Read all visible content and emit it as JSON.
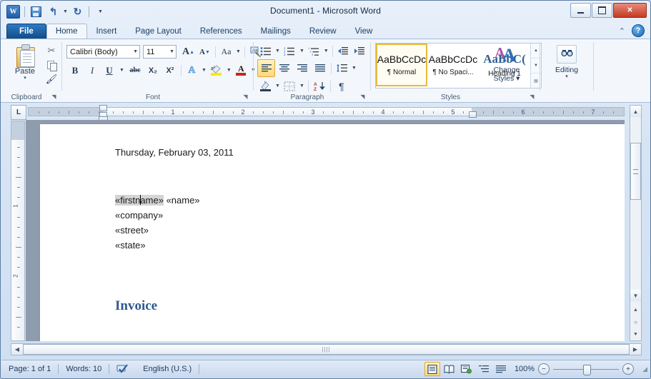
{
  "window": {
    "title": "Document1  -  Microsoft Word",
    "minimize_label": "Minimize",
    "maximize_label": "Maximize",
    "close_label": "✕"
  },
  "quick_access": {
    "app_logo": "W",
    "items": [
      {
        "name": "save-icon",
        "label": "Save"
      },
      {
        "name": "undo-icon",
        "label": "↰"
      },
      {
        "name": "redo-icon",
        "label": "↻"
      },
      {
        "name": "customize-qat-icon",
        "label": "▾"
      }
    ]
  },
  "tabs": [
    {
      "label": "File",
      "active": false,
      "file": true
    },
    {
      "label": "Home",
      "active": true
    },
    {
      "label": "Insert",
      "active": false
    },
    {
      "label": "Page Layout",
      "active": false
    },
    {
      "label": "References",
      "active": false
    },
    {
      "label": "Mailings",
      "active": false
    },
    {
      "label": "Review",
      "active": false
    },
    {
      "label": "View",
      "active": false
    }
  ],
  "tab_right": {
    "minimize_ribbon": "⌃",
    "help": "?"
  },
  "ribbon": {
    "clipboard": {
      "label": "Clipboard",
      "paste_label": "Paste",
      "paste_caret": "▾",
      "cut_label": "✂",
      "copy_label": "Copy",
      "format_painter_label": "Format Painter",
      "dialog_launcher": "◥"
    },
    "font": {
      "label": "Font",
      "font_name": "Calibri (Body)",
      "font_size": "11",
      "grow_font": "A",
      "shrink_font": "A",
      "change_case": "Aa",
      "clear_formatting": "Aa",
      "bold": "B",
      "italic": "I",
      "underline": "U",
      "strikethrough": "abc",
      "subscript": "X₂",
      "superscript": "X²",
      "text_effects": "A",
      "highlight": "ab",
      "font_color": "A",
      "caret": "▾",
      "dialog_launcher": "◥"
    },
    "paragraph": {
      "label": "Paragraph",
      "bullets": "Bullets",
      "numbering": "Numbering",
      "multilevel": "Multilevel List",
      "decrease_indent": "Decrease Indent",
      "increase_indent": "Increase Indent",
      "align_left": "Align Left",
      "align_center": "Center",
      "align_right": "Align Right",
      "justify": "Justify",
      "line_spacing": "Line Spacing",
      "shading": "Shading",
      "borders": "Borders",
      "sort": "Sort",
      "show_marks": "¶",
      "caret": "▾",
      "dialog_launcher": "◥"
    },
    "styles": {
      "label": "Styles",
      "gallery": [
        {
          "preview": "AaBbCcDc",
          "name": "¶ Normal",
          "selected": true,
          "heading": false
        },
        {
          "preview": "AaBbCcDc",
          "name": "¶ No Spaci...",
          "selected": false,
          "heading": false
        },
        {
          "preview": "AaBbC(",
          "name": "Heading 1",
          "selected": false,
          "heading": true
        }
      ],
      "nav_up": "▲",
      "nav_down": "▼",
      "nav_more": "▤",
      "change_styles_label": "Change\nStyles ▾",
      "change_styles_line1": "Change",
      "change_styles_line2": "Styles ▾",
      "dialog_launcher": "◥"
    },
    "editing": {
      "label": "Editing",
      "icon": "find-icon",
      "caret": "▾"
    }
  },
  "ruler": {
    "tab_selector": "L",
    "horizontal_numbers": [
      "1",
      "2",
      "3",
      "4",
      "5",
      "6",
      "7"
    ],
    "vertical_numbers": [
      "1",
      "2"
    ]
  },
  "document": {
    "date_line": "Thursday, February 03, 2011",
    "merge_line_field1_a": "«firstn",
    "merge_line_field1_b": "ame»",
    "merge_line_field2": "«name»",
    "company_field": "«company»",
    "street_field": "«street»",
    "state_field": "«state»",
    "invoice_heading": "Invoice"
  },
  "scrollbars": {
    "up_arrow": "▲",
    "down_arrow": "▼",
    "left_arrow": "◀",
    "right_arrow": "▶",
    "previous_page": "⯅",
    "select_browse_object": "○",
    "next_page": "⯆"
  },
  "status_bar": {
    "page": "Page: 1 of 1",
    "words": "Words: 10",
    "proofing_icon": "proofing-errors-icon",
    "language": "English (U.S.)",
    "views": [
      {
        "name": "print-layout-view",
        "glyph": "▤",
        "active": true
      },
      {
        "name": "full-screen-reading-view",
        "glyph": "▥",
        "active": false
      },
      {
        "name": "web-layout-view",
        "glyph": "▦",
        "active": false
      },
      {
        "name": "outline-view",
        "glyph": "▧",
        "active": false
      },
      {
        "name": "draft-view",
        "glyph": "▨",
        "active": false
      }
    ],
    "zoom_level": "100%",
    "zoom_out": "−",
    "zoom_in": "+"
  },
  "colors": {
    "accent_blue": "#1f5fa8",
    "file_tab": "#114c88",
    "highlight_gold": "#ffd878",
    "heading_blue": "#2e5a8e",
    "merge_field_shade": "#d4d4d4"
  }
}
